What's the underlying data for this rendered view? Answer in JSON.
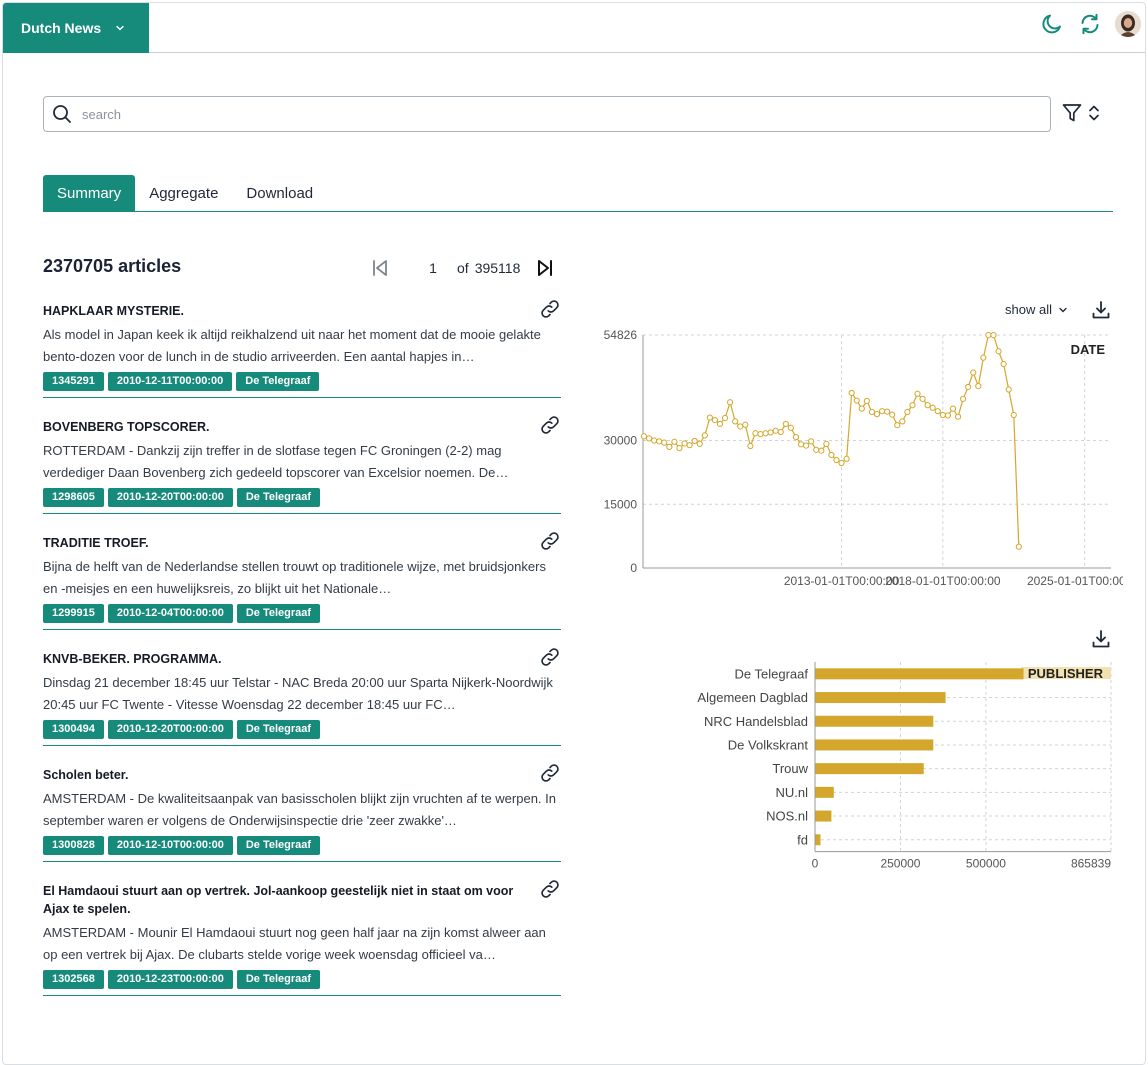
{
  "app": {
    "corpus_name": "Dutch News"
  },
  "search": {
    "placeholder": "search",
    "value": ""
  },
  "tabs": [
    {
      "label": "Summary",
      "active": true
    },
    {
      "label": "Aggregate",
      "active": false
    },
    {
      "label": "Download",
      "active": false
    }
  ],
  "results": {
    "count_label": "2370705 articles",
    "page_current": "1",
    "page_of_label": "of",
    "page_total": "395118"
  },
  "articles": [
    {
      "title": "HAPKLAAR MYSTERIE.",
      "text": "Als model in Japan keek ik altijd reikhalzend uit naar het moment dat de mooie gelakte bento-dozen voor de lunch in de studio arriveerden. Een aantal hapjes in…",
      "id": "1345291",
      "date": "2010-12-11T00:00:00",
      "publisher": "De Telegraaf"
    },
    {
      "title": "BOVENBERG TOPSCORER.",
      "text": "ROTTERDAM - Dankzij zijn treffer in de slotfase tegen FC Groningen (2-2) mag verdediger Daan Bovenberg zich gedeeld topscorer van Excelsior noemen. De…",
      "id": "1298605",
      "date": "2010-12-20T00:00:00",
      "publisher": "De Telegraaf"
    },
    {
      "title": "TRADITIE TROEF.",
      "text": "Bijna de helft van de Nederlandse stellen trouwt op traditionele wijze, met bruidsjonkers en -meisjes en een huwelijksreis, zo blijkt uit het Nationale…",
      "id": "1299915",
      "date": "2010-12-04T00:00:00",
      "publisher": "De Telegraaf"
    },
    {
      "title": "KNVB-BEKER. PROGRAMMA.",
      "text": "Dinsdag 21 december 18:45 uur Telstar - NAC Breda 20:00 uur Sparta Nijkerk-Noordwijk 20:45 uur FC Twente - Vitesse Woensdag 22 december 18:45 uur FC…",
      "id": "1300494",
      "date": "2010-12-20T00:00:00",
      "publisher": "De Telegraaf"
    },
    {
      "title": "Scholen beter.",
      "text": "AMSTERDAM - De kwaliteitsaanpak van basisscholen blijkt zijn vruchten af te werpen. In september waren er volgens de Onderwijsinspectie drie 'zeer zwakke'…",
      "id": "1300828",
      "date": "2010-12-10T00:00:00",
      "publisher": "De Telegraaf"
    },
    {
      "title": "El Hamdaoui stuurt aan op vertrek. Jol-aankoop geestelijk niet in staat om voor Ajax te spelen.",
      "text": "AMSTERDAM - Mounir El Hamdaoui stuurt nog geen half jaar na zijn komst alweer aan op een vertrek bij Ajax. De clubarts stelde vorige week woensdag officieel va…",
      "id": "1302568",
      "date": "2010-12-23T00:00:00",
      "publisher": "De Telegraaf"
    }
  ],
  "controls": {
    "show_all_label": "show all"
  },
  "icons": {
    "brand_dropdown": "chevron-down-icon",
    "theme": "moon-icon",
    "refresh": "refresh-icon",
    "search": "search-icon",
    "filter": "filter-icon",
    "sort": "chevron-up-down-icon",
    "first_page": "first-page-icon",
    "last_page": "last-page-icon",
    "link": "link-icon",
    "download": "download-icon"
  },
  "colors": {
    "accent": "#168a7b",
    "chart": "#d4a72c",
    "chart_highlight": "#f2e2b0"
  },
  "chart_data": [
    {
      "type": "line",
      "title": "DATE",
      "x_tick_labels": [
        "2013-01-01T00:00:00",
        "2018-01-01T00:00:00",
        "2025-01-01T00:00:00"
      ],
      "y_tick_labels": [
        "54826",
        "30000",
        "15000",
        "0"
      ],
      "ylim": [
        0,
        54826
      ],
      "xlim_years": [
        2003.2,
        2026.3
      ],
      "grid": true,
      "x_years": [
        2003.25,
        2003.5,
        2003.75,
        2004.0,
        2004.25,
        2004.5,
        2004.75,
        2005.0,
        2005.25,
        2005.5,
        2005.75,
        2006.0,
        2006.25,
        2006.5,
        2006.75,
        2007.0,
        2007.25,
        2007.5,
        2007.75,
        2008.0,
        2008.25,
        2008.5,
        2008.75,
        2009.0,
        2009.25,
        2009.5,
        2009.75,
        2010.0,
        2010.25,
        2010.5,
        2010.75,
        2011.0,
        2011.25,
        2011.5,
        2011.75,
        2012.0,
        2012.25,
        2012.5,
        2012.75,
        2013.0,
        2013.25,
        2013.5,
        2013.75,
        2014.0,
        2014.25,
        2014.5,
        2014.75,
        2015.0,
        2015.25,
        2015.5,
        2015.75,
        2016.0,
        2016.25,
        2016.5,
        2016.75,
        2017.0,
        2017.25,
        2017.5,
        2017.75,
        2018.0,
        2018.25,
        2018.5,
        2018.75,
        2019.0,
        2019.25,
        2019.5,
        2019.75,
        2020.0,
        2020.25,
        2020.5,
        2020.75,
        2021.0,
        2021.25,
        2021.5,
        2021.75,
        2022.0,
        2022.25,
        2022.5,
        2022.75,
        2023.0,
        2023.25,
        2023.5,
        2023.75,
        2024.0,
        2024.25,
        2024.5,
        2024.75,
        2025.0,
        2025.25,
        2025.5,
        2025.75,
        2026.0,
        2026.2
      ],
      "values": [
        31000,
        30500,
        30000,
        29800,
        29500,
        28500,
        29700,
        28200,
        29300,
        28900,
        29900,
        29200,
        31200,
        35400,
        34800,
        33900,
        35300,
        39000,
        34500,
        33300,
        33700,
        28700,
        31700,
        31500,
        31700,
        31900,
        32300,
        32000,
        33900,
        33000,
        30800,
        29100,
        28800,
        29800,
        27800,
        27600,
        29200,
        26600,
        25400,
        24700,
        25700,
        41200,
        39400,
        37500,
        39300,
        36700,
        36200,
        36900,
        36800,
        36100,
        33600,
        34500,
        36700,
        38300,
        41000,
        39800,
        38300,
        37700,
        36900,
        36000,
        35900,
        37500,
        35600,
        39800,
        42600,
        46000,
        42800,
        49500,
        54800,
        54800,
        51000,
        48000,
        42000,
        36000,
        5000
      ]
    },
    {
      "type": "bar",
      "orientation": "horizontal",
      "title": "PUBLISHER",
      "categories": [
        "De Telegraaf",
        "Algemeen Dagblad",
        "NRC Handelsblad",
        "De Volkskrant",
        "Trouw",
        "NU.nl",
        "NOS.nl",
        "fd"
      ],
      "values": [
        610000,
        382000,
        346000,
        346000,
        318000,
        55000,
        48000,
        16000
      ],
      "x_tick_labels": [
        "0",
        "250000",
        "500000",
        "865839"
      ],
      "xlim": [
        0,
        865839
      ],
      "grid": true
    }
  ]
}
